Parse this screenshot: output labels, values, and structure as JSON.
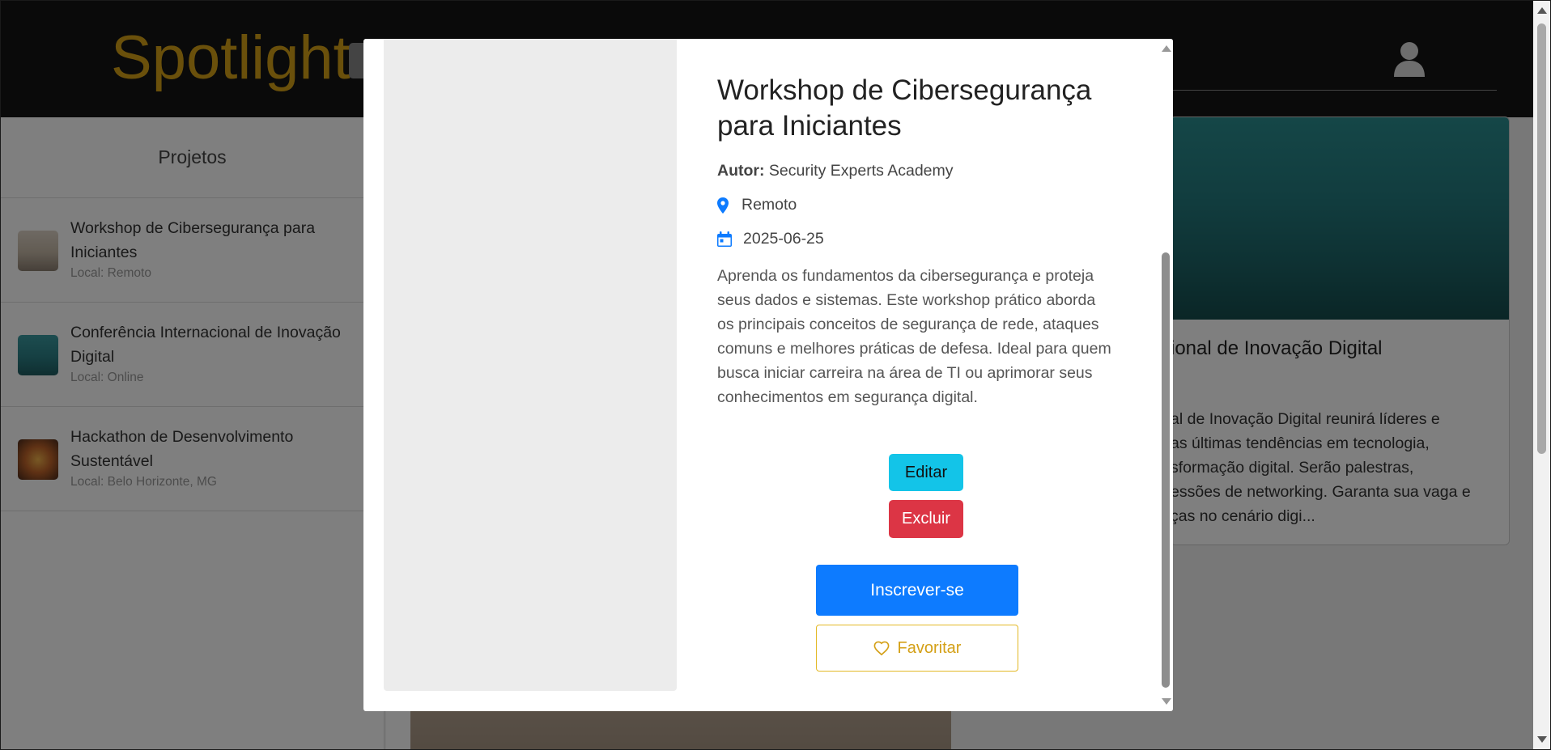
{
  "header": {
    "brand": "Spotlight",
    "user_icon": "user-icon"
  },
  "sidebar": {
    "title": "Projetos",
    "items": [
      {
        "title": "Workshop de Cibersegurança para Iniciantes",
        "local": "Local: Remoto",
        "thumb_color": "#c8bba7"
      },
      {
        "title": "Conferência Internacional de Inovação Digital",
        "local": "Local: Online",
        "thumb_color": "#2b7f85"
      },
      {
        "title": "Hackathon de Desenvolvimento Sustentável",
        "local": "Local: Belo Horizonte, MG",
        "thumb_color": "#b0552a"
      }
    ]
  },
  "background_card": {
    "title_fragment": "ional de Inovação Digital",
    "text_fragment": "al de Inovação Digital reunirá líderes e\nas últimas tendências em tecnologia,\nsformação digital. Serão palestras,\nessões de networking. Garanta sua vaga e\nças no cenário digi..."
  },
  "modal": {
    "title": "Workshop de Cibersegurança para Iniciantes",
    "autor_label": "Autor:",
    "autor_value": "Security Experts Academy",
    "location": "Remoto",
    "date": "2025-06-25",
    "description": "Aprenda os fundamentos da cibersegurança e proteja seus dados e sistemas. Este workshop prático aborda os principais conceitos de segurança de rede, ataques comuns e melhores práticas de defesa. Ideal para quem busca iniciar carreira na área de TI ou aprimorar seus conhecimentos em segurança digital.",
    "edit_label": "Editar",
    "delete_label": "Excluir",
    "subscribe_label": "Inscrever-se",
    "favorite_label": "Favoritar",
    "accent_colors": {
      "primary": "#0d7bff",
      "info": "#13c4e8",
      "danger": "#dc3545",
      "warning": "#d4a017"
    }
  }
}
